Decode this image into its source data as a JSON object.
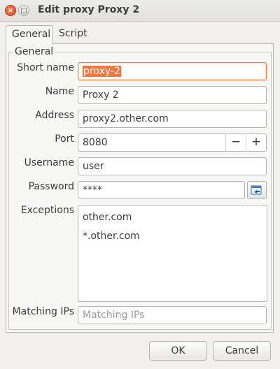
{
  "window": {
    "title": "Edit proxy Proxy 2"
  },
  "tabs": [
    {
      "label": "General"
    },
    {
      "label": "Script"
    }
  ],
  "general_frame": {
    "label": "General"
  },
  "fields": {
    "short_name": {
      "label": "Short name",
      "value": "proxy-2"
    },
    "name": {
      "label": "Name",
      "value": "Proxy 2"
    },
    "address": {
      "label": "Address",
      "value": "proxy2.other.com"
    },
    "port": {
      "label": "Port",
      "value": "8080",
      "minus": "−",
      "plus": "+"
    },
    "username": {
      "label": "Username",
      "value": "user"
    },
    "password": {
      "label": "Password",
      "value": "****"
    },
    "exceptions": {
      "label": "Exceptions",
      "lines": [
        "other.com",
        "*.other.com"
      ]
    },
    "matching_ips": {
      "label": "Matching IPs",
      "placeholder": "Matching IPs"
    }
  },
  "buttons": {
    "ok": "OK",
    "cancel": "Cancel"
  },
  "colors": {
    "focus_accent": "#f07746"
  },
  "icons": {
    "close": "close-icon",
    "maximize": "maximize-icon",
    "password_action": "password-generate-icon"
  }
}
